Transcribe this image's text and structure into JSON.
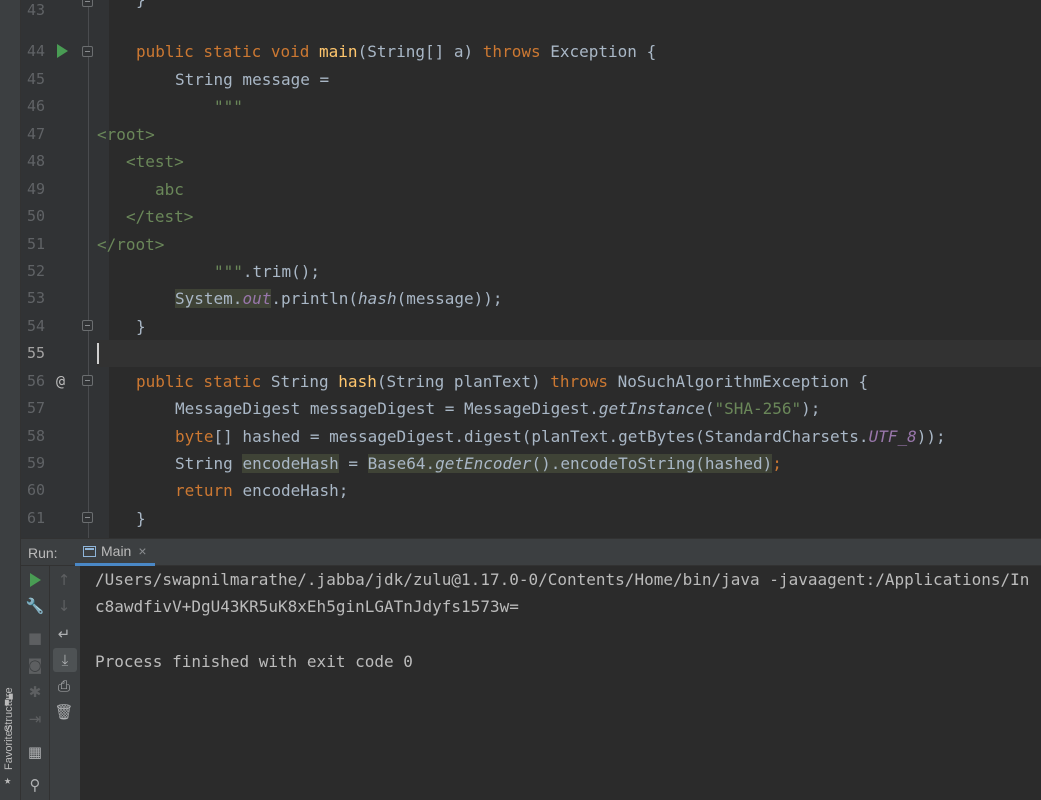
{
  "editor": {
    "line_numbers": [
      "43",
      "44",
      "45",
      "46",
      "47",
      "48",
      "49",
      "50",
      "51",
      "52",
      "53",
      "54",
      "55",
      "56",
      "57",
      "58",
      "59",
      "60",
      "61"
    ],
    "lines": {
      "l44": {
        "kw1": "public static void ",
        "fn": "main",
        "rest": "(String[] a) ",
        "kw2": "throws ",
        "tail": "Exception {"
      },
      "l45": "String message =",
      "l46": "\"\"\"",
      "l47": "<root>",
      "l48": "<test>",
      "l49": "abc",
      "l50": "</test>",
      "l51": "</root>",
      "l52": {
        "str": "\"\"\"",
        "rest": ".trim();"
      },
      "l53": {
        "sys": "System.",
        "out": "out",
        "mid": ".println(",
        "hash": "hash",
        "tail": "(message));"
      },
      "l54": "}",
      "l56": {
        "kw1": "public static ",
        "type": "String ",
        "fn": "hash",
        "rest": "(String planText) ",
        "kw2": "throws ",
        "tail": "NoSuchAlgorithmException {"
      },
      "l57": {
        "a": "MessageDigest messageDigest = MessageDigest.",
        "m": "getInstance",
        "b": "(",
        "s": "\"SHA-256\"",
        "c": ");"
      },
      "l58": {
        "kw": "byte",
        "a": "[] hashed = messageDigest.digest(planText.getBytes(StandardCharsets.",
        "st": "UTF_8",
        "b": "));"
      },
      "l59": {
        "a": "String ",
        "v": "encodeHash",
        "b": " = ",
        "c": "Base64.",
        "m": "getEncoder",
        "d": "().encodeToString(hashed)",
        "e": ";"
      },
      "l60": {
        "kw": "return ",
        "a": "encodeHash;"
      },
      "l61": "}"
    },
    "gutter_marker_56": "@"
  },
  "run_panel": {
    "label": "Run:",
    "tab_label": "Main",
    "tab_close": "×",
    "console_lines": [
      "/Users/swapnilmarathe/.jabba/jdk/zulu@1.17.0-0/Contents/Home/bin/java -javaagent:/Applications/In",
      "c8awdfivV+DgU43KR5uK8xEh5ginLGATnJdyfs1573w=",
      "",
      "Process finished with exit code 0"
    ]
  },
  "side_tabs": {
    "structure": "Structure",
    "favorites": "Favorites"
  },
  "icons": [
    "run-icon",
    "arrow-up-icon",
    "arrow-down-icon",
    "wrench-icon",
    "soft-wrap-icon",
    "stop-icon",
    "scroll-to-end-icon",
    "camera-icon",
    "print-icon",
    "bug-icon",
    "trash-icon",
    "exit-icon",
    "layout-icon",
    "pin-icon",
    "star-icon"
  ]
}
